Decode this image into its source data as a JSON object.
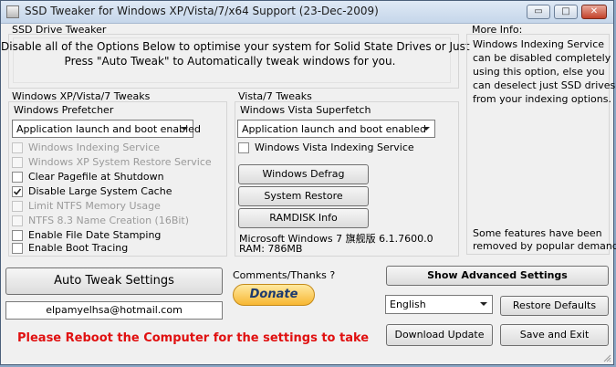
{
  "window": {
    "title": "SSD Tweaker for Windows XP/Vista/7/x64 Support (23-Dec-2009)"
  },
  "titlebar_buttons": {
    "minimize": "▭",
    "maximize": "□",
    "close": "✕"
  },
  "ssd_drive_tweaker": {
    "title": "SSD Drive Tweaker",
    "line1": "Disable all of the Options Below to optimise your system for Solid State Drives or Just",
    "line2": "Press \"Auto Tweak\" to Automatically tweak windows for you."
  },
  "more_info": {
    "title": "More Info:",
    "lines": [
      "Windows Indexing Service",
      "can be disabled completely",
      "using this option, else you",
      "can deselect just SSD drives",
      "from your indexing options."
    ],
    "footer_lines": [
      "Some features have been",
      "removed by popular demand."
    ]
  },
  "left_group": {
    "title": "Windows XP/Vista/7 Tweaks",
    "prefetcher_label": "Windows Prefetcher",
    "prefetcher_value": "Application launch and boot enabled",
    "options": [
      {
        "label": "Windows Indexing Service",
        "checked": false,
        "enabled": false
      },
      {
        "label": "Windows XP System Restore Service",
        "checked": false,
        "enabled": false
      },
      {
        "label": "Clear Pagefile at Shutdown",
        "checked": false,
        "enabled": true
      },
      {
        "label": "Disable Large System Cache",
        "checked": true,
        "enabled": true
      },
      {
        "label": "Limit NTFS Memory Usage",
        "checked": false,
        "enabled": false
      },
      {
        "label": "NTFS 8.3 Name Creation (16Bit)",
        "checked": false,
        "enabled": false
      },
      {
        "label": "Enable File Date Stamping",
        "checked": false,
        "enabled": true
      },
      {
        "label": "Enable Boot Tracing",
        "checked": false,
        "enabled": true
      }
    ]
  },
  "vista_group": {
    "title": "Vista/7 Tweaks",
    "superfetch_label": "Windows Vista Superfetch",
    "superfetch_value": "Application launch and boot enabled",
    "indexing_label": "Windows Vista Indexing Service",
    "indexing_checked": false,
    "defrag_button": "Windows Defrag",
    "restore_button": "System Restore",
    "ramdisk_button": "RAMDISK Info",
    "os_info": "Microsoft Windows 7 旗舰版  6.1.7600.0",
    "ram_info": "RAM: 786MB"
  },
  "bottom": {
    "auto_tweak_button": "Auto Tweak Settings",
    "email": "elpamyelhsa@hotmail.com",
    "comments_label": "Comments/Thanks ?",
    "donate_button": "Donate",
    "reboot_message": "Please Reboot the Computer for the settings to take",
    "show_advanced_button": "Show Advanced Settings",
    "language_value": "English",
    "restore_defaults_button": "Restore Defaults",
    "download_update_button": "Download Update",
    "save_exit_button": "Save and Exit"
  },
  "colors": {
    "reboot_text": "#e01010",
    "donate_bg": "#f7b733",
    "donate_text": "#1c3a6e"
  }
}
